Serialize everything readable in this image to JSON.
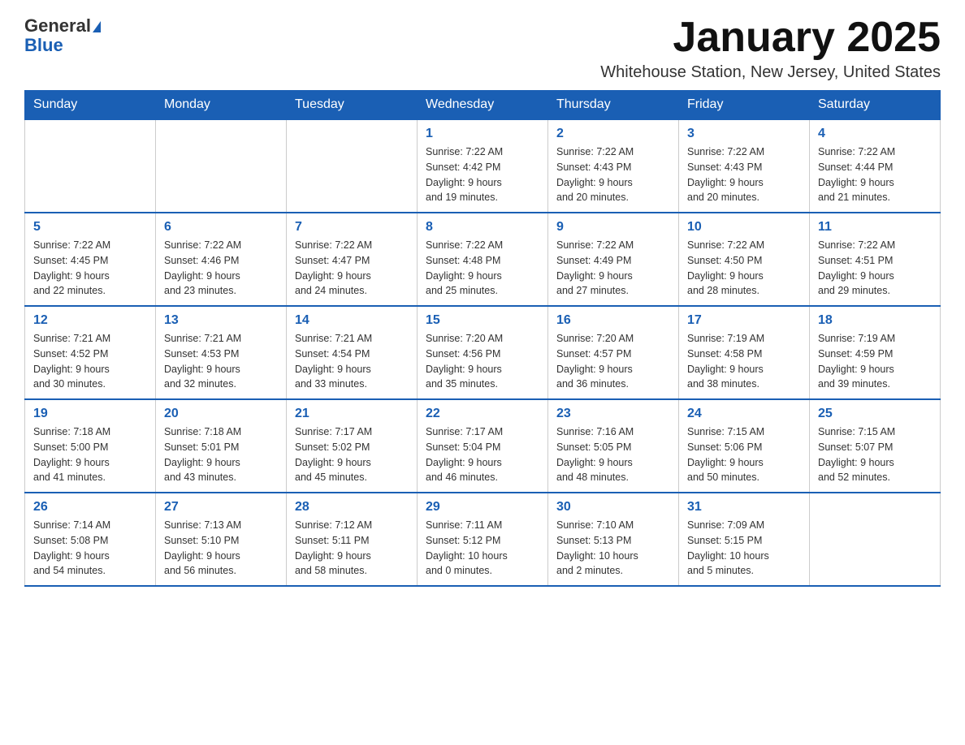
{
  "header": {
    "logo_general": "General",
    "logo_blue": "Blue",
    "month_title": "January 2025",
    "location": "Whitehouse Station, New Jersey, United States"
  },
  "weekdays": [
    "Sunday",
    "Monday",
    "Tuesday",
    "Wednesday",
    "Thursday",
    "Friday",
    "Saturday"
  ],
  "weeks": [
    [
      {
        "day": "",
        "info": ""
      },
      {
        "day": "",
        "info": ""
      },
      {
        "day": "",
        "info": ""
      },
      {
        "day": "1",
        "info": "Sunrise: 7:22 AM\nSunset: 4:42 PM\nDaylight: 9 hours\nand 19 minutes."
      },
      {
        "day": "2",
        "info": "Sunrise: 7:22 AM\nSunset: 4:43 PM\nDaylight: 9 hours\nand 20 minutes."
      },
      {
        "day": "3",
        "info": "Sunrise: 7:22 AM\nSunset: 4:43 PM\nDaylight: 9 hours\nand 20 minutes."
      },
      {
        "day": "4",
        "info": "Sunrise: 7:22 AM\nSunset: 4:44 PM\nDaylight: 9 hours\nand 21 minutes."
      }
    ],
    [
      {
        "day": "5",
        "info": "Sunrise: 7:22 AM\nSunset: 4:45 PM\nDaylight: 9 hours\nand 22 minutes."
      },
      {
        "day": "6",
        "info": "Sunrise: 7:22 AM\nSunset: 4:46 PM\nDaylight: 9 hours\nand 23 minutes."
      },
      {
        "day": "7",
        "info": "Sunrise: 7:22 AM\nSunset: 4:47 PM\nDaylight: 9 hours\nand 24 minutes."
      },
      {
        "day": "8",
        "info": "Sunrise: 7:22 AM\nSunset: 4:48 PM\nDaylight: 9 hours\nand 25 minutes."
      },
      {
        "day": "9",
        "info": "Sunrise: 7:22 AM\nSunset: 4:49 PM\nDaylight: 9 hours\nand 27 minutes."
      },
      {
        "day": "10",
        "info": "Sunrise: 7:22 AM\nSunset: 4:50 PM\nDaylight: 9 hours\nand 28 minutes."
      },
      {
        "day": "11",
        "info": "Sunrise: 7:22 AM\nSunset: 4:51 PM\nDaylight: 9 hours\nand 29 minutes."
      }
    ],
    [
      {
        "day": "12",
        "info": "Sunrise: 7:21 AM\nSunset: 4:52 PM\nDaylight: 9 hours\nand 30 minutes."
      },
      {
        "day": "13",
        "info": "Sunrise: 7:21 AM\nSunset: 4:53 PM\nDaylight: 9 hours\nand 32 minutes."
      },
      {
        "day": "14",
        "info": "Sunrise: 7:21 AM\nSunset: 4:54 PM\nDaylight: 9 hours\nand 33 minutes."
      },
      {
        "day": "15",
        "info": "Sunrise: 7:20 AM\nSunset: 4:56 PM\nDaylight: 9 hours\nand 35 minutes."
      },
      {
        "day": "16",
        "info": "Sunrise: 7:20 AM\nSunset: 4:57 PM\nDaylight: 9 hours\nand 36 minutes."
      },
      {
        "day": "17",
        "info": "Sunrise: 7:19 AM\nSunset: 4:58 PM\nDaylight: 9 hours\nand 38 minutes."
      },
      {
        "day": "18",
        "info": "Sunrise: 7:19 AM\nSunset: 4:59 PM\nDaylight: 9 hours\nand 39 minutes."
      }
    ],
    [
      {
        "day": "19",
        "info": "Sunrise: 7:18 AM\nSunset: 5:00 PM\nDaylight: 9 hours\nand 41 minutes."
      },
      {
        "day": "20",
        "info": "Sunrise: 7:18 AM\nSunset: 5:01 PM\nDaylight: 9 hours\nand 43 minutes."
      },
      {
        "day": "21",
        "info": "Sunrise: 7:17 AM\nSunset: 5:02 PM\nDaylight: 9 hours\nand 45 minutes."
      },
      {
        "day": "22",
        "info": "Sunrise: 7:17 AM\nSunset: 5:04 PM\nDaylight: 9 hours\nand 46 minutes."
      },
      {
        "day": "23",
        "info": "Sunrise: 7:16 AM\nSunset: 5:05 PM\nDaylight: 9 hours\nand 48 minutes."
      },
      {
        "day": "24",
        "info": "Sunrise: 7:15 AM\nSunset: 5:06 PM\nDaylight: 9 hours\nand 50 minutes."
      },
      {
        "day": "25",
        "info": "Sunrise: 7:15 AM\nSunset: 5:07 PM\nDaylight: 9 hours\nand 52 minutes."
      }
    ],
    [
      {
        "day": "26",
        "info": "Sunrise: 7:14 AM\nSunset: 5:08 PM\nDaylight: 9 hours\nand 54 minutes."
      },
      {
        "day": "27",
        "info": "Sunrise: 7:13 AM\nSunset: 5:10 PM\nDaylight: 9 hours\nand 56 minutes."
      },
      {
        "day": "28",
        "info": "Sunrise: 7:12 AM\nSunset: 5:11 PM\nDaylight: 9 hours\nand 58 minutes."
      },
      {
        "day": "29",
        "info": "Sunrise: 7:11 AM\nSunset: 5:12 PM\nDaylight: 10 hours\nand 0 minutes."
      },
      {
        "day": "30",
        "info": "Sunrise: 7:10 AM\nSunset: 5:13 PM\nDaylight: 10 hours\nand 2 minutes."
      },
      {
        "day": "31",
        "info": "Sunrise: 7:09 AM\nSunset: 5:15 PM\nDaylight: 10 hours\nand 5 minutes."
      },
      {
        "day": "",
        "info": ""
      }
    ]
  ]
}
